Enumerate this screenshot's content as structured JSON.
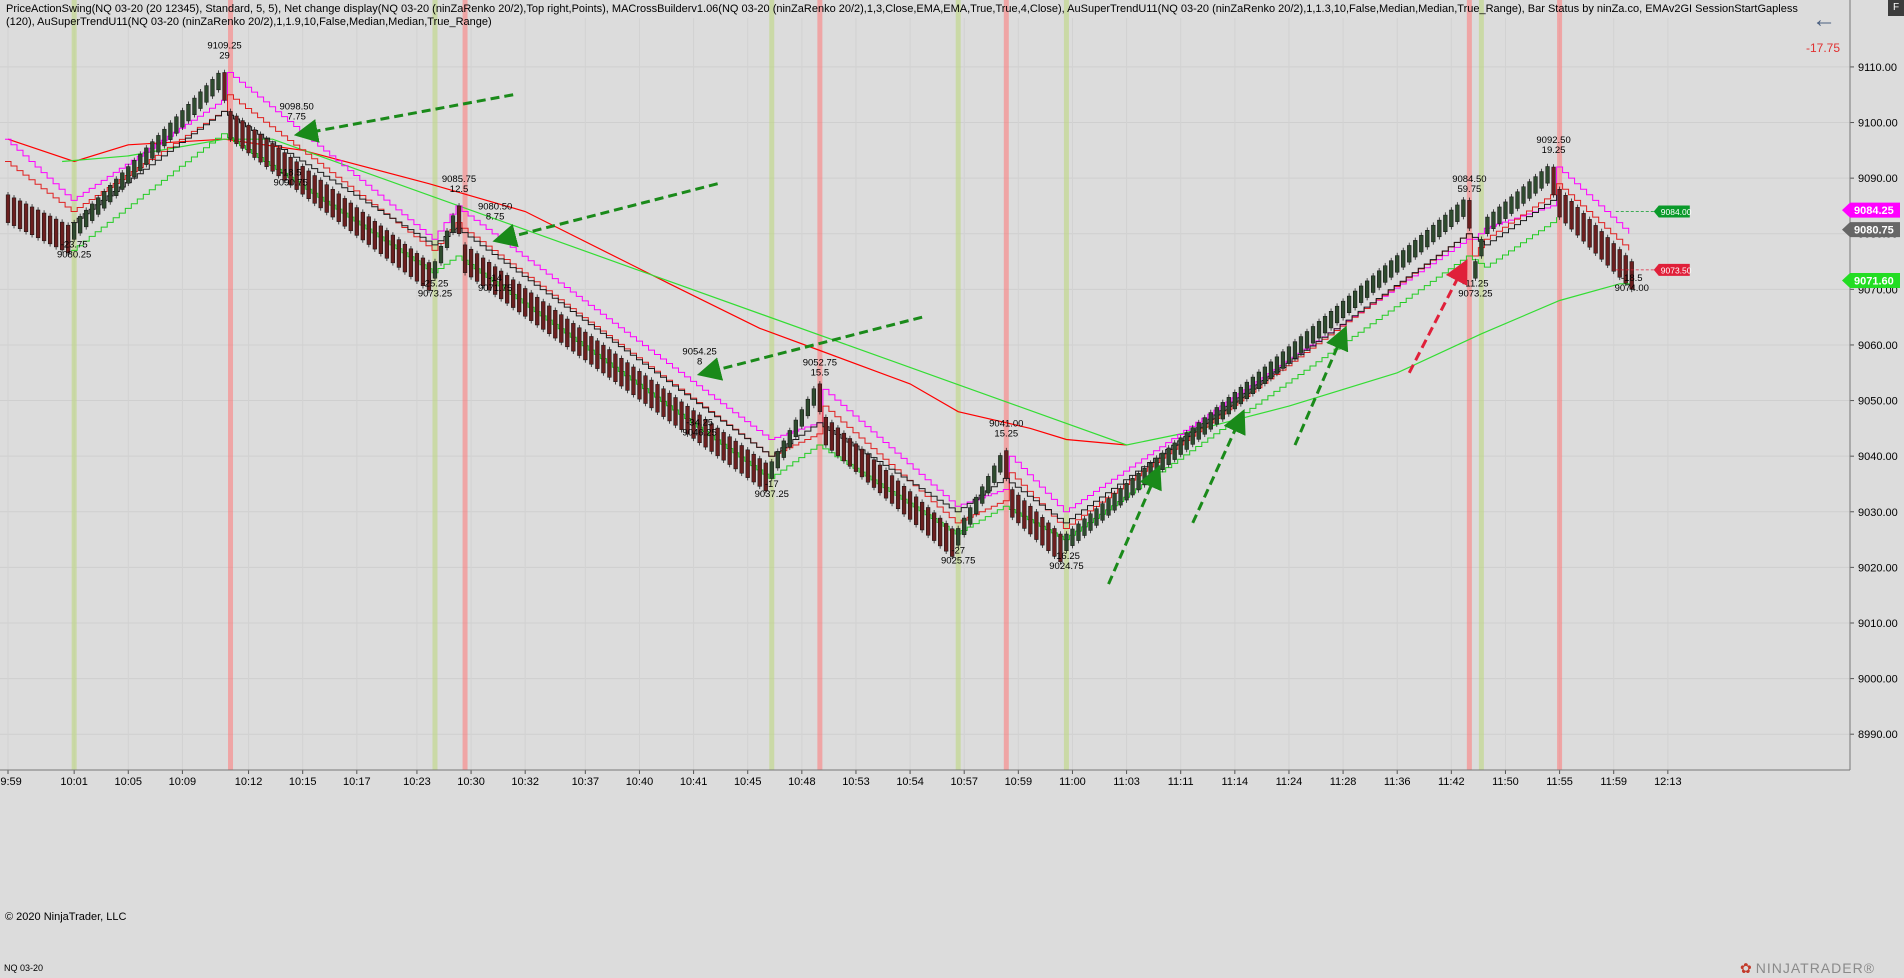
{
  "header": {
    "indicators_text": "PriceActionSwing(NQ 03-20 (20 12345), Standard, 5, 5), Net change display(NQ 03-20 (ninZaRenko 20/2),Top right,Points), MACrossBuilderv1.06(NQ 03-20 (ninZaRenko 20/2),1,3,Close,EMA,EMA,True,True,4,Close), AuSuperTrendU11(NQ 03-20 (ninZaRenko 20/2),1,1.3,10,False,Median,Median,True_Range), Bar Status by ninZa.co, EMAv2GI SessionStartGapless (120), AuSuperTrendU11(NQ 03-20 (ninZaRenko 20/2),1,1.9,10,False,Median,Median,True_Range)",
    "net_change": "-17.75",
    "corner_label": "F"
  },
  "footer": {
    "copyright": "© 2020 NinjaTrader, LLC",
    "instrument": "NQ 03-20",
    "brand": "NINJATRADER",
    "brand_mark": "®"
  },
  "colors": {
    "background": "#dcdcdc",
    "up_bar": "#2e4a2e",
    "down_bar": "#6b1f1f",
    "pink_line": "#ff00ff",
    "red_ema": "#ff0000",
    "green_ema": "#33dd33",
    "arrow_green": "#1a8a1a",
    "arrow_red": "#e0203a"
  },
  "chart_data": {
    "type": "line",
    "instrument": "NQ 03-20",
    "y_axis": {
      "ylim": [
        8985,
        9117
      ],
      "ticks": [
        8990,
        9000,
        9010,
        9020,
        9030,
        9040,
        9050,
        9060,
        9070,
        9080,
        9090,
        9100,
        9110
      ],
      "tick_labels": [
        "8990.00",
        "9000.00",
        "9010.00",
        "9020.00",
        "9030.00",
        "9040.00",
        "9050.00",
        "9060.00",
        "9070.00",
        "9080.00",
        "9090.00",
        "9100.00",
        "9110.00"
      ],
      "gridlines": true
    },
    "x_axis": {
      "xlim": [
        0,
        288
      ],
      "ticks": [
        {
          "x": 0,
          "label": "09:59"
        },
        {
          "x": 11,
          "label": "10:01"
        },
        {
          "x": 20,
          "label": "10:05"
        },
        {
          "x": 29,
          "label": "10:09"
        },
        {
          "x": 40,
          "label": "10:12"
        },
        {
          "x": 49,
          "label": "10:15"
        },
        {
          "x": 58,
          "label": "10:17"
        },
        {
          "x": 68,
          "label": "10:23"
        },
        {
          "x": 77,
          "label": "10:30"
        },
        {
          "x": 86,
          "label": "10:32"
        },
        {
          "x": 96,
          "label": "10:37"
        },
        {
          "x": 105,
          "label": "10:40"
        },
        {
          "x": 114,
          "label": "10:41"
        },
        {
          "x": 123,
          "label": "10:45"
        },
        {
          "x": 132,
          "label": "10:48"
        },
        {
          "x": 141,
          "label": "10:53"
        },
        {
          "x": 150,
          "label": "10:54"
        },
        {
          "x": 159,
          "label": "10:57"
        },
        {
          "x": 168,
          "label": "10:59"
        },
        {
          "x": 177,
          "label": "11:00"
        },
        {
          "x": 186,
          "label": "11:03"
        },
        {
          "x": 195,
          "label": "11:11"
        },
        {
          "x": 204,
          "label": "11:14"
        },
        {
          "x": 213,
          "label": "11:24"
        },
        {
          "x": 222,
          "label": "11:28"
        },
        {
          "x": 231,
          "label": "11:36"
        },
        {
          "x": 240,
          "label": "11:42"
        },
        {
          "x": 249,
          "label": "11:50"
        },
        {
          "x": 258,
          "label": "11:55"
        },
        {
          "x": 267,
          "label": "11:59"
        },
        {
          "x": 276,
          "label": "12:13"
        }
      ]
    },
    "price_path": [
      [
        0,
        9086
      ],
      [
        11,
        9080
      ],
      [
        36,
        9108
      ],
      [
        37,
        9101
      ],
      [
        71,
        9073
      ],
      [
        75,
        9084
      ],
      [
        76,
        9077
      ],
      [
        127,
        9037
      ],
      [
        135,
        9052
      ],
      [
        136,
        9046
      ],
      [
        158,
        9025
      ],
      [
        166,
        9040
      ],
      [
        167,
        9033
      ],
      [
        176,
        9024
      ],
      [
        243,
        9085
      ],
      [
        244,
        9073
      ],
      [
        246,
        9081
      ],
      [
        257,
        9091
      ],
      [
        258,
        9087
      ],
      [
        270,
        9074
      ]
    ],
    "pink_line": [
      [
        0,
        9097
      ],
      [
        11,
        9086
      ],
      [
        36,
        9104
      ],
      [
        37,
        9109
      ],
      [
        71,
        9079
      ],
      [
        75,
        9085
      ],
      [
        76,
        9084
      ],
      [
        127,
        9043
      ],
      [
        135,
        9046
      ],
      [
        136,
        9052
      ],
      [
        158,
        9031
      ],
      [
        166,
        9034
      ],
      [
        167,
        9040
      ],
      [
        176,
        9030
      ],
      [
        243,
        9079
      ],
      [
        244,
        9079
      ],
      [
        246,
        9081
      ],
      [
        257,
        9085
      ],
      [
        258,
        9092
      ],
      [
        270,
        9080
      ]
    ],
    "red_line": [
      [
        0,
        9093
      ],
      [
        11,
        9084
      ],
      [
        36,
        9102
      ],
      [
        37,
        9105
      ],
      [
        71,
        9077
      ],
      [
        75,
        9082
      ],
      [
        76,
        9081
      ],
      [
        127,
        9040
      ],
      [
        135,
        9044
      ],
      [
        136,
        9049
      ],
      [
        158,
        9028
      ],
      [
        166,
        9032
      ],
      [
        167,
        9037
      ],
      [
        176,
        9027
      ],
      [
        243,
        9080
      ],
      [
        244,
        9076
      ],
      [
        246,
        9079
      ],
      [
        257,
        9087
      ],
      [
        258,
        9089
      ],
      [
        270,
        9077
      ]
    ],
    "black_trend": [
      [
        11,
        9082
      ],
      [
        36,
        9102
      ],
      [
        71,
        9078
      ],
      [
        75,
        9081
      ],
      [
        127,
        9040
      ],
      [
        135,
        9046
      ],
      [
        158,
        9030
      ],
      [
        166,
        9036
      ],
      [
        176,
        9028
      ],
      [
        243,
        9080
      ],
      [
        246,
        9078
      ],
      [
        257,
        9086
      ],
      [
        258,
        9087
      ]
    ],
    "green_trend": [
      [
        11,
        9077
      ],
      [
        36,
        9098
      ],
      [
        71,
        9073
      ],
      [
        75,
        9076
      ],
      [
        127,
        9036
      ],
      [
        135,
        9042
      ],
      [
        158,
        9026
      ],
      [
        166,
        9031
      ],
      [
        176,
        9025
      ],
      [
        243,
        9076
      ],
      [
        246,
        9074
      ],
      [
        257,
        9082
      ],
      [
        258,
        9083
      ]
    ],
    "ema_red": [
      [
        0,
        9097
      ],
      [
        11,
        9093
      ],
      [
        20,
        9096
      ],
      [
        36,
        9097
      ],
      [
        49,
        9095
      ],
      [
        70,
        9089
      ],
      [
        86,
        9084
      ],
      [
        110,
        9071
      ],
      [
        125,
        9063
      ],
      [
        135,
        9059
      ],
      [
        150,
        9053
      ],
      [
        158,
        9048
      ],
      [
        170,
        9045
      ],
      [
        176,
        9043
      ],
      [
        186,
        9042
      ]
    ],
    "ema_green": [
      [
        9,
        9093
      ],
      [
        20,
        9094
      ],
      [
        36,
        9097
      ],
      [
        44,
        9097
      ],
      [
        186,
        9042
      ],
      [
        195,
        9044
      ],
      [
        213,
        9049
      ],
      [
        231,
        9055
      ],
      [
        245,
        9062
      ],
      [
        258,
        9068
      ],
      [
        268,
        9071
      ],
      [
        270,
        9071
      ]
    ],
    "vertical_markers": [
      {
        "x": 11,
        "color": "green"
      },
      {
        "x": 37,
        "color": "red"
      },
      {
        "x": 71,
        "color": "green"
      },
      {
        "x": 76,
        "color": "red"
      },
      {
        "x": 127,
        "color": "green"
      },
      {
        "x": 135,
        "color": "red"
      },
      {
        "x": 158,
        "color": "green"
      },
      {
        "x": 166,
        "color": "red"
      },
      {
        "x": 176,
        "color": "green"
      },
      {
        "x": 243,
        "color": "red"
      },
      {
        "x": 245,
        "color": "green"
      },
      {
        "x": 258,
        "color": "red"
      }
    ],
    "swing_labels": [
      {
        "x": 11,
        "price": 9080,
        "position": "below",
        "lines": [
          "-23.75",
          "9080.25"
        ]
      },
      {
        "x": 36,
        "price": 9109,
        "position": "above",
        "lines": [
          "9109.25",
          "29"
        ]
      },
      {
        "x": 48,
        "price": 9098,
        "position": "above",
        "lines": [
          "9098.50",
          "7.75"
        ]
      },
      {
        "x": 47,
        "price": 9093,
        "position": "below",
        "lines": [
          "-18.5",
          "9090.75"
        ]
      },
      {
        "x": 75,
        "price": 9085,
        "position": "above",
        "lines": [
          "9085.75",
          "12.5"
        ]
      },
      {
        "x": 71,
        "price": 9073,
        "position": "below",
        "lines": [
          "-25.25",
          "9073.25"
        ]
      },
      {
        "x": 81,
        "price": 9080,
        "position": "above",
        "lines": [
          "9080.50",
          "8.75"
        ]
      },
      {
        "x": 81,
        "price": 9074,
        "position": "below",
        "lines": [
          "-14",
          "9071.75"
        ]
      },
      {
        "x": 115,
        "price": 9054,
        "position": "above",
        "lines": [
          "9054.25",
          "8"
        ]
      },
      {
        "x": 115,
        "price": 9048,
        "position": "below",
        "lines": [
          "-34.25",
          "9046.25"
        ]
      },
      {
        "x": 135,
        "price": 9052,
        "position": "above",
        "lines": [
          "9052.75",
          "15.5"
        ]
      },
      {
        "x": 127,
        "price": 9037,
        "position": "below",
        "lines": [
          "-17",
          "9037.25"
        ]
      },
      {
        "x": 166,
        "price": 9041,
        "position": "above",
        "lines": [
          "9041.00",
          "15.25"
        ]
      },
      {
        "x": 158,
        "price": 9025,
        "position": "below",
        "lines": [
          "-27",
          "9025.75"
        ]
      },
      {
        "x": 176,
        "price": 9024,
        "position": "below",
        "lines": [
          "-16.25",
          "9024.75"
        ]
      },
      {
        "x": 243,
        "price": 9085,
        "position": "above",
        "lines": [
          "9084.50",
          "59.75"
        ]
      },
      {
        "x": 244,
        "price": 9073,
        "position": "below",
        "lines": [
          "-11.25",
          "9073.25"
        ]
      },
      {
        "x": 257,
        "price": 9092,
        "position": "above",
        "lines": [
          "9092.50",
          "19.25"
        ]
      },
      {
        "x": 270,
        "price": 9074,
        "position": "below",
        "lines": [
          "-18.5",
          "9074.00"
        ]
      }
    ],
    "arrows": [
      {
        "from": [
          84,
          9105
        ],
        "to": [
          49,
          9098
        ],
        "color": "green",
        "dashed": true
      },
      {
        "from": [
          118,
          9089
        ],
        "to": [
          82,
          9079
        ],
        "color": "green",
        "dashed": true
      },
      {
        "from": [
          152,
          9065
        ],
        "to": [
          116,
          9055
        ],
        "color": "green",
        "dashed": true
      },
      {
        "from": [
          183,
          9017
        ],
        "to": [
          191,
          9037
        ],
        "color": "green",
        "dashed": true
      },
      {
        "from": [
          197,
          9028
        ],
        "to": [
          205,
          9047
        ],
        "color": "green",
        "dashed": true
      },
      {
        "from": [
          214,
          9042
        ],
        "to": [
          222,
          9062
        ],
        "color": "green",
        "dashed": true
      },
      {
        "from": [
          233,
          9055
        ],
        "to": [
          242,
          9074
        ],
        "color": "red",
        "dashed": true
      }
    ],
    "price_flags": [
      {
        "price": 9084,
        "label": "9084.00",
        "color": "#0a9a2a",
        "position": "chart",
        "x": 272
      },
      {
        "price": 9073.5,
        "label": "9073.50",
        "color": "#e0203a",
        "position": "chart",
        "x": 272
      },
      {
        "price": 9084.25,
        "label": "9084.25",
        "color": "#ff00ff",
        "position": "axis"
      },
      {
        "price": 9080.75,
        "label": "9080.75",
        "color": "#666666",
        "position": "axis"
      },
      {
        "price": 9071.6,
        "label": "9071.60",
        "color": "#22dd22",
        "position": "axis"
      }
    ]
  }
}
